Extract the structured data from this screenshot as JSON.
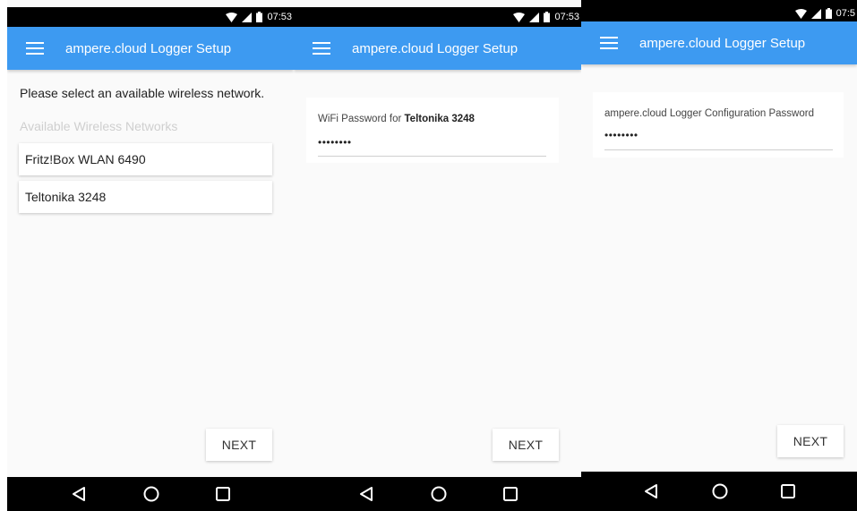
{
  "screens": [
    {
      "status": {
        "time": "07:53"
      },
      "appbar": {
        "title": "ampere.cloud Logger Setup"
      },
      "instruction": "Please select an available wireless network.",
      "section_label": "Available Wireless Networks",
      "networks": [
        {
          "label": "Fritz!Box WLAN 6490"
        },
        {
          "label": "Teltonika 3248"
        }
      ],
      "next_label": "NEXT"
    },
    {
      "status": {
        "time": "07:53"
      },
      "appbar": {
        "title": "ampere.cloud Logger Setup"
      },
      "field_label_prefix": "WiFi Password for ",
      "field_label_network": "Teltonika 3248",
      "password_value": "••••••••",
      "next_label": "NEXT"
    },
    {
      "status": {
        "time": "07:5"
      },
      "appbar": {
        "title": "ampere.cloud Logger Setup"
      },
      "field_label": "ampere.cloud Logger Configuration Password",
      "password_value": "••••••••",
      "next_label": "NEXT"
    }
  ],
  "icons": {
    "menu": "menu-icon",
    "wifi": "wifi-icon",
    "signal": "signal-icon",
    "battery": "battery-icon",
    "back": "back-icon",
    "home": "home-icon",
    "recents": "recents-icon"
  },
  "colors": {
    "appbar": "#3d9af1",
    "background": "#fafafa"
  }
}
